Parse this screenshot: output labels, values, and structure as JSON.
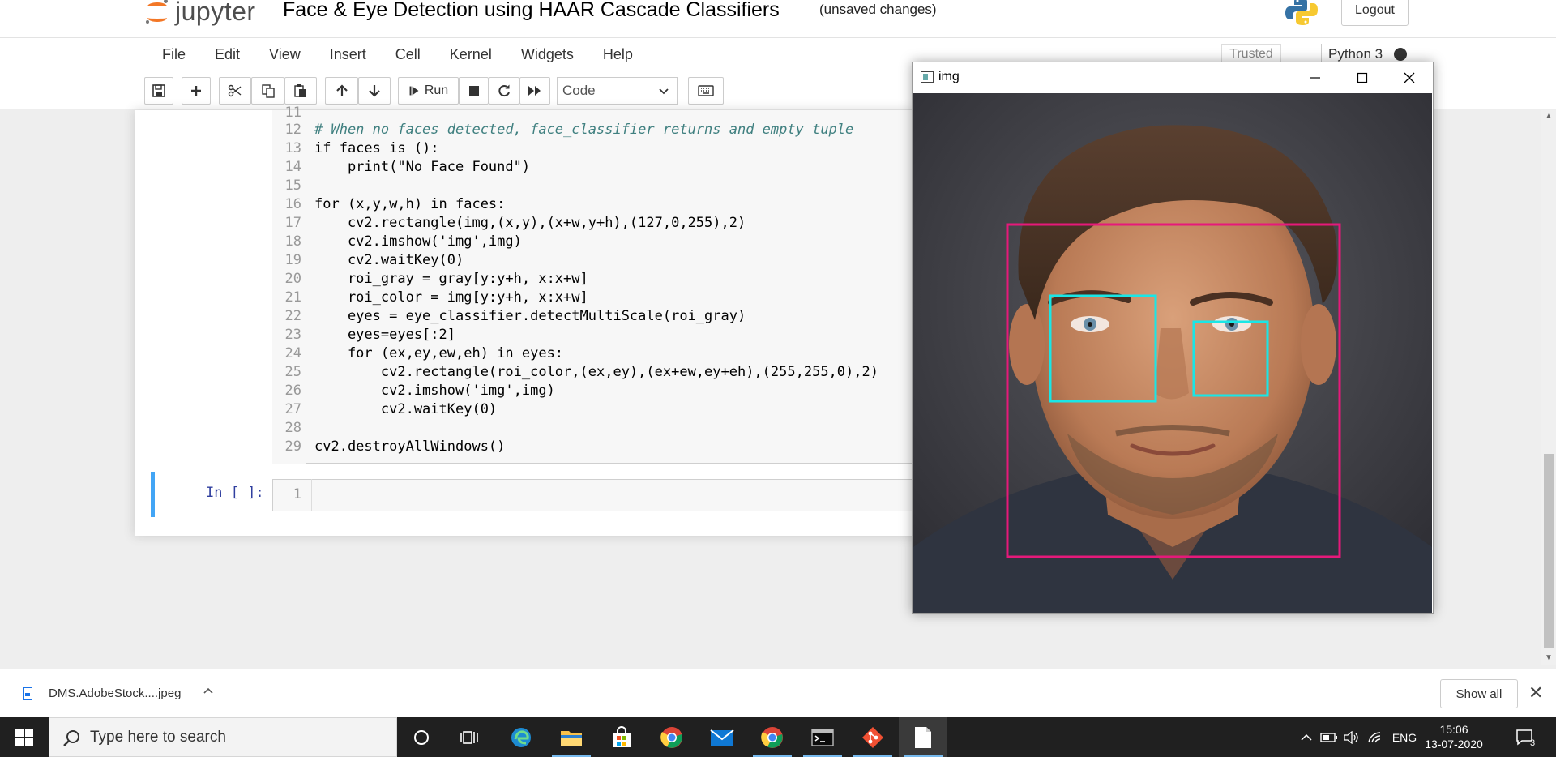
{
  "header": {
    "logo_text": "jupyter",
    "notebook_title": "Face & Eye Detection using HAAR Cascade Classifiers",
    "save_status": "(unsaved changes)",
    "logout_label": "Logout"
  },
  "menu": {
    "items": [
      "File",
      "Edit",
      "View",
      "Insert",
      "Cell",
      "Kernel",
      "Widgets",
      "Help"
    ],
    "trusted_label": "Trusted",
    "kernel_name": "Python 3"
  },
  "toolbar": {
    "run_label": "Run",
    "cell_type": "Code"
  },
  "code_cell": {
    "lines": [
      {
        "n": "11",
        "text": ""
      },
      {
        "n": "12",
        "text": "# When no faces detected, face_classifier returns and empty tuple"
      },
      {
        "n": "13",
        "text": "if faces is ():"
      },
      {
        "n": "14",
        "text": "    print(\"No Face Found\")"
      },
      {
        "n": "15",
        "text": ""
      },
      {
        "n": "16",
        "text": "for (x,y,w,h) in faces:"
      },
      {
        "n": "17",
        "text": "    cv2.rectangle(img,(x,y),(x+w,y+h),(127,0,255),2)"
      },
      {
        "n": "18",
        "text": "    cv2.imshow('img',img)"
      },
      {
        "n": "19",
        "text": "    cv2.waitKey(0)"
      },
      {
        "n": "20",
        "text": "    roi_gray = gray[y:y+h, x:x+w]"
      },
      {
        "n": "21",
        "text": "    roi_color = img[y:y+h, x:x+w]"
      },
      {
        "n": "22",
        "text": "    eyes = eye_classifier.detectMultiScale(roi_gray)"
      },
      {
        "n": "23",
        "text": "    eyes=eyes[:2]"
      },
      {
        "n": "24",
        "text": "    for (ex,ey,ew,eh) in eyes:"
      },
      {
        "n": "25",
        "text": "        cv2.rectangle(roi_color,(ex,ey),(ex+ew,ey+eh),(255,255,0),2)"
      },
      {
        "n": "26",
        "text": "        cv2.imshow('img',img)"
      },
      {
        "n": "27",
        "text": "        cv2.waitKey(0)"
      },
      {
        "n": "28",
        "text": ""
      },
      {
        "n": "29",
        "text": "cv2.destroyAllWindows()"
      }
    ]
  },
  "new_cell": {
    "prompt": "In [ ]:",
    "line_number": "1"
  },
  "img_window": {
    "title": "img",
    "face_box_color": "#e6197a",
    "eye_box_color": "#19e6e6"
  },
  "download_bar": {
    "filename": "DMS.AdobeStock....jpeg",
    "show_all_label": "Show all"
  },
  "taskbar": {
    "search_placeholder": "Type here to search",
    "language": "ENG",
    "time": "15:06",
    "date": "13-07-2020",
    "notification_count": "3"
  },
  "colors": {
    "jupyter_orange": "#f37726",
    "cell_selected_border": "#42a5f5",
    "taskbar_bg": "#202020"
  }
}
